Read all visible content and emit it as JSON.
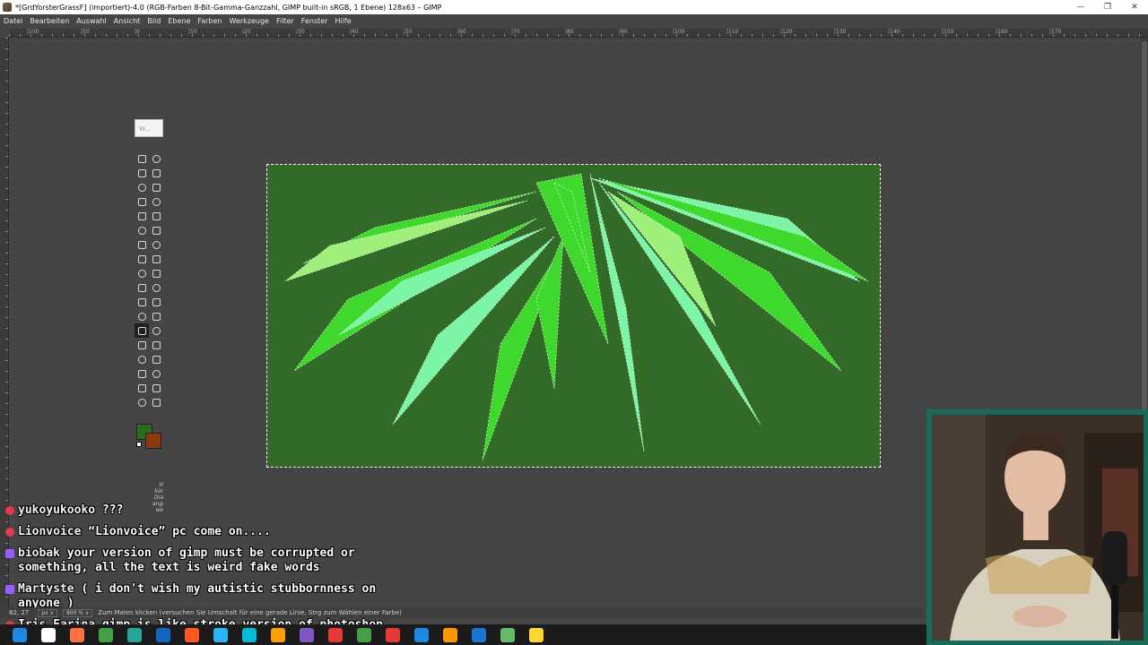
{
  "window": {
    "title": "*[GrdYorsterGrassF] (importiert)-4.0 (RGB-Farben 8-Bit-Gamma-Ganzzahl, GIMP built-in sRGB, 1 Ebene) 128x63 – GIMP",
    "controls": [
      "—",
      "❐",
      "✕"
    ]
  },
  "menu": [
    "Datei",
    "Bearbeiten",
    "Auswahl",
    "Ansicht",
    "Bild",
    "Ebene",
    "Farben",
    "Werkzeuge",
    "Filter",
    "Fenster",
    "Hilfe"
  ],
  "ruler_labels": [
    "|100",
    "|50",
    "|0",
    "|10",
    "|20",
    "|30",
    "|40",
    "|50",
    "|60",
    "|70",
    "|80",
    "|90",
    "|100",
    "|110",
    "|120",
    "|130",
    "|140",
    "|150",
    "|160",
    "|170"
  ],
  "toolbox": {
    "header": "W...",
    "tools": [
      "rect-select",
      "ellipse-select",
      "free-select",
      "fuzzy-select",
      "select-by-color",
      "scissors",
      "foreground-select",
      "zoom",
      "paths",
      "measure",
      "align",
      "move",
      "crop",
      "unified-transform",
      "rotate",
      "shear",
      "perspective",
      "flip",
      "cage",
      "warp",
      "handle-transform",
      "text",
      "bucket-fill",
      "blend",
      "paintbrush",
      "pencil",
      "eraser",
      "airbrush",
      "ink",
      "mypaint",
      "clone",
      "heal",
      "smudge",
      "dodge",
      "color-picker",
      "blur"
    ],
    "selected_index": 24,
    "side_text": "H kör Dia ange we",
    "fg_color": "#2e6b1f",
    "bg_color": "#8a3a10"
  },
  "canvas": {
    "bg": "#316b27",
    "light": "#7cf5a6",
    "mid": "#3fd92e",
    "pale": "#9ff07a"
  },
  "chat": [
    {
      "badge": "red",
      "user": "yukoyukooko",
      "text": "???"
    },
    {
      "badge": "red",
      "user": "Lionvoice",
      "text": "“Lionvoice” pc come on...."
    },
    {
      "badge": "purple",
      "user": "biobak",
      "text": "your version of gimp must be corrupted or",
      "text2": "something, all the text is weird fake words"
    },
    {
      "badge": "purple",
      "user": "Martyste",
      "text": "( i don't wish my autistic stubbornness on",
      "text2": "anyone )"
    },
    {
      "badge": "red",
      "user": "Iris Farina",
      "text": "gimp is like stroke version of photoshop"
    }
  ],
  "status": {
    "coords": "82, 27",
    "unit": "px ∨",
    "zoom": "800 % ∨",
    "message": "Zum Malen klicken (versuchen Sie Umschalt für eine gerade Linie, Strg zum Wählen einer Farbe)"
  },
  "taskbar_colors": [
    "#1e88e5",
    "#ffffff",
    "#ff7043",
    "#43a047",
    "#26a69a",
    "#1565c0",
    "#ff5722",
    "#29b6f6",
    "#00bcd4",
    "#ffa000",
    "#7e57c2",
    "#e53935",
    "#43a047",
    "#e53935",
    "#1e88e5",
    "#ff9800",
    "#1976d2",
    "#66bb6a",
    "#fdd835"
  ]
}
